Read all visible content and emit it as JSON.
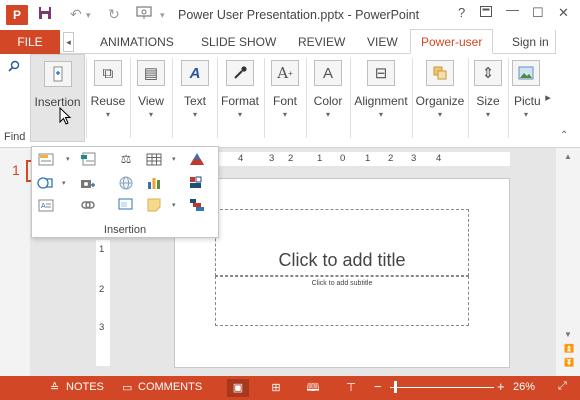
{
  "app": {
    "logo_text": "P",
    "window_title": "Power User Presentation.pptx - PowerPoint"
  },
  "quick_access": [
    {
      "name": "save-icon",
      "glyph": "💾"
    },
    {
      "name": "undo-icon",
      "glyph": "↶"
    },
    {
      "name": "undo-dropdown-icon",
      "glyph": "▾"
    },
    {
      "name": "redo-icon",
      "glyph": "↻"
    },
    {
      "name": "present-icon",
      "glyph": "⊡"
    },
    {
      "name": "customize-qat-icon",
      "glyph": "▾"
    }
  ],
  "window_controls": {
    "help": "?",
    "ribbon_options": "⊞",
    "minimize": "—",
    "restore": "☐",
    "close": "✕"
  },
  "tabs": {
    "file": "FILE",
    "items": [
      "ANIMATIONS",
      "SLIDE SHOW",
      "REVIEW",
      "VIEW",
      "Power-user"
    ],
    "active": "Power-user",
    "sign_in": "Sign in"
  },
  "ribbon": {
    "find_label": "Find",
    "buttons": [
      {
        "label": "Insertion",
        "icon": "insertion-icon"
      },
      {
        "label": "Reuse",
        "icon": "reuse-icon"
      },
      {
        "label": "View",
        "icon": "view-icon"
      },
      {
        "label": "Text",
        "icon": "text-icon"
      },
      {
        "label": "Format",
        "icon": "format-icon"
      },
      {
        "label": "Font",
        "icon": "font-icon"
      },
      {
        "label": "Color",
        "icon": "color-icon"
      },
      {
        "label": "Alignment",
        "icon": "alignment-icon"
      },
      {
        "label": "Organize",
        "icon": "organize-icon"
      },
      {
        "label": "Size",
        "icon": "size-icon"
      },
      {
        "label": "Pictu",
        "icon": "picture-icon"
      }
    ]
  },
  "dropdown": {
    "group_label": "Insertion",
    "items": [
      "insert-text-icon",
      "insert-table-layout-icon",
      "scales-icon",
      "table-grid-icon",
      "pyramid-icon",
      "shapes-icon",
      "camera-icon",
      "globe-icon",
      "bar-chart-icon",
      "flag-icon",
      "textbox-icon",
      "link-icon",
      "picture-frame-icon",
      "sticky-note-icon",
      "stacked-shapes-icon"
    ]
  },
  "slide": {
    "number": "1",
    "title_placeholder": "Click to add title",
    "subtitle_placeholder": "Click to add subtitle"
  },
  "rulers": {
    "horizontal": [
      "4",
      "3",
      "2",
      "1",
      "0",
      "1",
      "2",
      "3",
      "4"
    ],
    "vertical": [
      "1",
      "2",
      "3"
    ]
  },
  "statusbar": {
    "notes": "NOTES",
    "comments": "COMMENTS",
    "zoom": "26%"
  },
  "colors": {
    "accent": "#d24726",
    "accent_dark": "#a9391e"
  }
}
